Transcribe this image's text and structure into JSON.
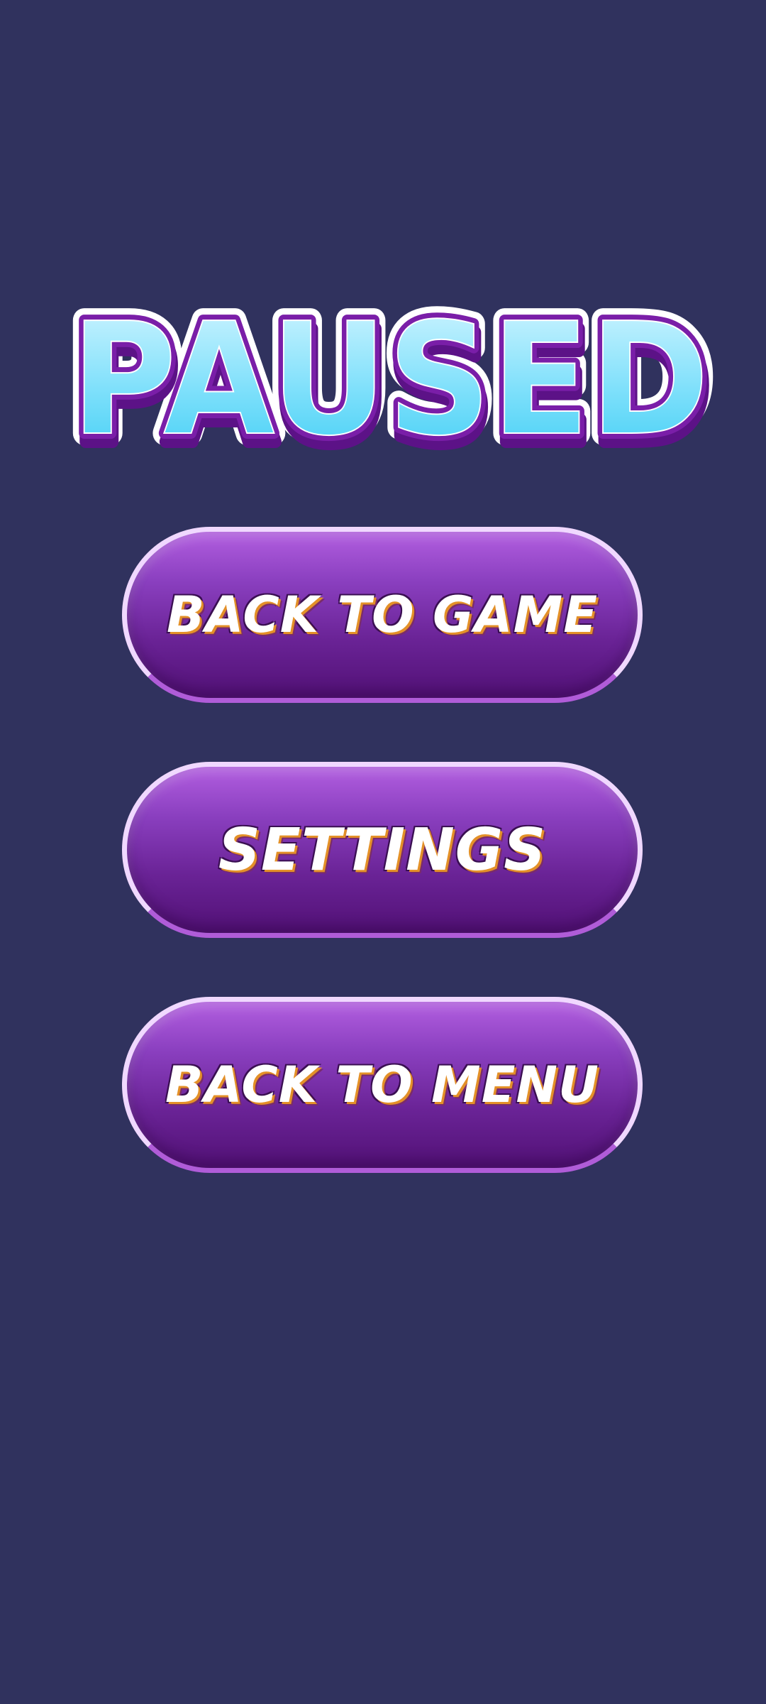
{
  "screen": {
    "name": "pause-menu",
    "background_color": "#30325e"
  },
  "title": {
    "text": "PAUSED",
    "fill_top_color": "#d6f6ff",
    "fill_bottom_color": "#3ccdf4",
    "outline_color": "#7a1ea8",
    "border_color": "#ffffff"
  },
  "buttons": {
    "back_to_game": "BACK TO GAME",
    "settings": "SETTINGS",
    "back_to_menu": "BACK TO MENU"
  },
  "button_colors": {
    "top": "#b25ee0",
    "bottom": "#521176",
    "rim": "#f0d8ff",
    "text_shadow": "#e39028"
  }
}
